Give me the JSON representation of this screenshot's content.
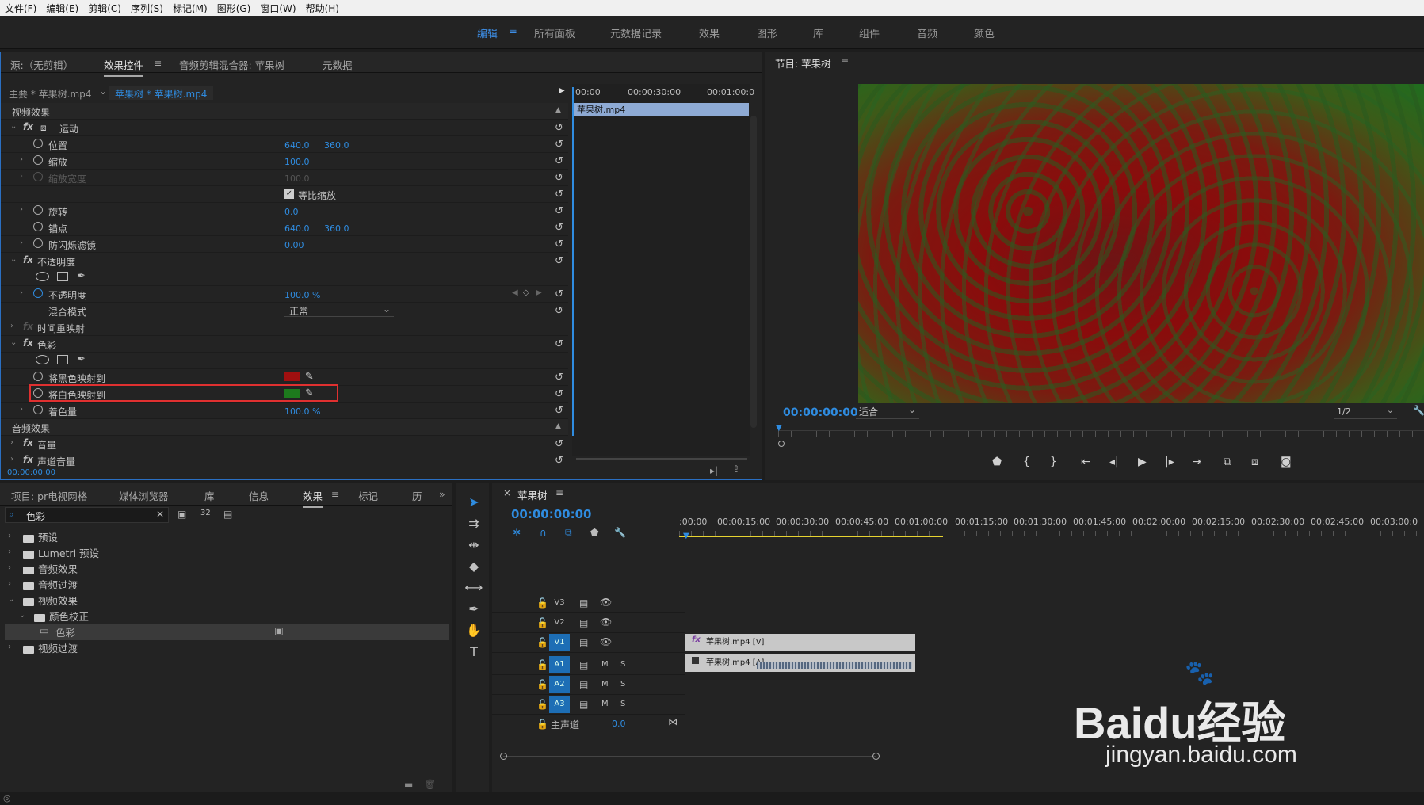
{
  "menu": [
    "文件(F)",
    "编辑(E)",
    "剪辑(C)",
    "序列(S)",
    "标记(M)",
    "图形(G)",
    "窗口(W)",
    "帮助(H)"
  ],
  "workspaces": {
    "edit": "编辑",
    "panels": "所有面板",
    "metadata": "元数据记录",
    "effects": "效果",
    "graphics": "图形",
    "library": "库",
    "assembly": "组件",
    "audio": "音频",
    "color": "颜色"
  },
  "top_panel": {
    "source": "源:（无剪辑）",
    "effect_controls": "效果控件",
    "audio_mixer": "音频剪辑混合器: 苹果树",
    "metadata": "元数据"
  },
  "ec": {
    "master": "主要 * 苹果树.mp4",
    "clip": "苹果树 * 苹果树.mp4",
    "ruler": [
      "00:00",
      "00:00:30:00",
      "00:01:00:0"
    ],
    "clip_bar": "苹果树.mp4",
    "video_effects": "视频效果",
    "motion": "运动",
    "position": "位置",
    "position_x": "640.0",
    "position_y": "360.0",
    "scale": "缩放",
    "scale_val": "100.0",
    "scale_width": "缩放宽度",
    "scale_width_val": "100.0",
    "uniform": "等比缩放",
    "rotation": "旋转",
    "rotation_val": "0.0",
    "anchor": "锚点",
    "anchor_x": "640.0",
    "anchor_y": "360.0",
    "flicker": "防闪烁滤镜",
    "flicker_val": "0.00",
    "opacity_group": "不透明度",
    "opacity": "不透明度",
    "opacity_val": "100.0 %",
    "blend": "混合模式",
    "blend_val": "正常",
    "time_remap": "时间重映射",
    "tint": "色彩",
    "map_black": "将黑色映射到",
    "map_black_color": "#a01010",
    "map_white": "将白色映射到",
    "map_white_color": "#1d7a1d",
    "amount": "着色量",
    "amount_val": "100.0 %",
    "audio_effects": "音频效果",
    "volume": "音量",
    "channel_volume": "声道音量",
    "timecode": "00:00:00:00"
  },
  "program": {
    "title": "节目: 苹果树",
    "timecode": "00:00:00:00",
    "fit": "适合",
    "res": "1/2"
  },
  "project": {
    "tabs": [
      "项目: pr电视网格",
      "媒体浏览器",
      "库",
      "信息",
      "效果",
      "标记",
      "历"
    ],
    "search": "色彩",
    "items": [
      "预设",
      "Lumetri 预设",
      "音频效果",
      "音频过渡",
      "视频效果",
      "颜色校正",
      "色彩",
      "视频过渡"
    ]
  },
  "timeline": {
    "name": "苹果树",
    "timecode": "00:00:00:00",
    "ruler": [
      ":00:00",
      "00:00:15:00",
      "00:00:30:00",
      "00:00:45:00",
      "00:01:00:00",
      "00:01:15:00",
      "00:01:30:00",
      "00:01:45:00",
      "00:02:00:00",
      "00:02:15:00",
      "00:02:30:00",
      "00:02:45:00",
      "00:03:00:0"
    ],
    "tracks": {
      "v3": "V3",
      "v2": "V2",
      "v1": "V1",
      "a1": "A1",
      "a2": "A2",
      "a3": "A3",
      "m": "M",
      "s": "S",
      "master": "主声道",
      "master_val": "0.0"
    },
    "video_clip": "苹果树.mp4 [V]",
    "audio_clip": "苹果树.mp4 [A]"
  },
  "watermark": {
    "brand": "Baidu经验",
    "url": "jingyan.baidu.com"
  }
}
